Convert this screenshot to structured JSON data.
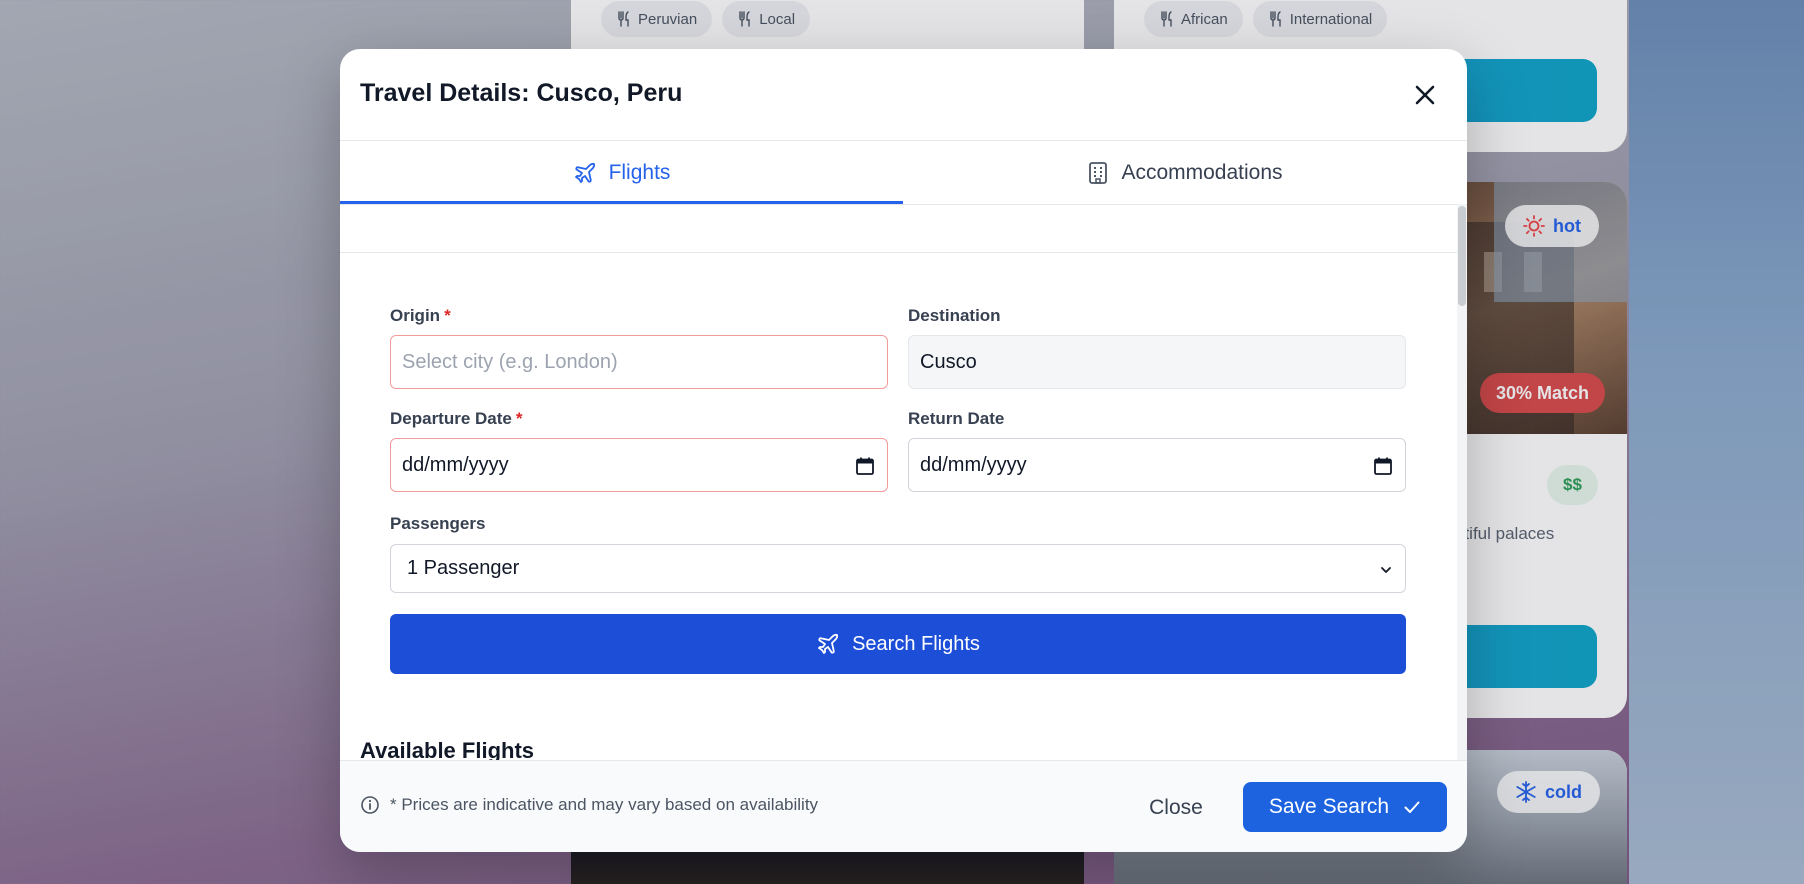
{
  "background": {
    "card_left_tags": [
      {
        "label": "Peruvian",
        "icon": "utensils-icon"
      },
      {
        "label": "Local",
        "icon": "utensils-icon"
      }
    ],
    "card_right_tags": [
      {
        "label": "African",
        "icon": "utensils-icon"
      },
      {
        "label": "International",
        "icon": "utensils-icon"
      }
    ],
    "weather_hot": "hot",
    "weather_cold": "cold",
    "match_badge": "30% Match",
    "price_badge": "$$",
    "description_fragment": "utiful palaces"
  },
  "modal": {
    "title": "Travel Details: Cusco, Peru",
    "tabs": [
      {
        "label": "Flights",
        "icon": "plane-icon",
        "active": true
      },
      {
        "label": "Accommodations",
        "icon": "building-icon",
        "active": false
      }
    ],
    "form": {
      "origin_label": "Origin",
      "origin_required": "*",
      "origin_placeholder": "Select city (e.g. London)",
      "destination_label": "Destination",
      "destination_value": "Cusco",
      "departure_label": "Departure Date",
      "departure_required": "*",
      "departure_value": "dd/mm/yyyy",
      "return_label": "Return Date",
      "return_value": "dd/mm/yyyy",
      "passengers_label": "Passengers",
      "passengers_value": "1 Passenger",
      "search_button": "Search Flights"
    },
    "available_flights_title": "Available Flights",
    "footer": {
      "note": "* Prices are indicative and may vary based on availability",
      "close_label": "Close",
      "save_label": "Save Search"
    }
  },
  "colors": {
    "accent": "#1d4ed8",
    "error_border": "#f29b9b",
    "required": "#dc2626",
    "match_badge": "#d94b4b",
    "cta": "#1e9fd8"
  }
}
